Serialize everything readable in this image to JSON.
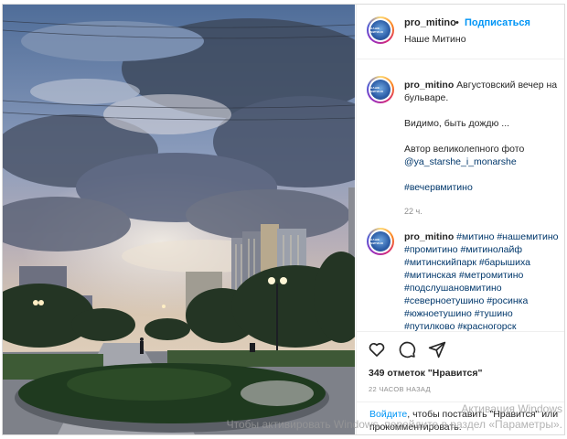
{
  "post": {
    "username": "pro_mitino",
    "separator": "•",
    "follow_label": "Подписаться",
    "location": "Наше Митино",
    "avatar_text": "НАШЕ МИТИНО"
  },
  "caption": {
    "username": "pro_mitino",
    "line1": "Августовский вечер на бульваре.",
    "line2": "Видимо, быть дождю ...",
    "line3": "Автор великолепного фото",
    "author_link": "@ya_starshe_i_monarshe",
    "hashtag": "#вечервмитино",
    "time": "22 ч."
  },
  "comment": {
    "username": "pro_mitino",
    "hashtags": "#митино #нашемитино #промитино #митинолайф #митинскийпарк #барышиха #митинская #метромитино #подслушановмитино #северноетушино #росинка #южноетушино #тушино #путилково #красногорск"
  },
  "actions": {
    "like_icon": "heart-icon",
    "comment_icon": "comment-icon",
    "share_icon": "paper-plane-icon",
    "likes_text": "349 отметок \"Нравится\"",
    "posted_time": "22 ЧАСОВ НАЗАД"
  },
  "login": {
    "login_link": "Войдите",
    "rest": ", чтобы поставить \"Нравится\" или прокомментировать."
  },
  "watermark": {
    "line1": "Активация Windows",
    "line2": "Чтобы активировать Windows, перейдите в раздел «Параметры»."
  }
}
